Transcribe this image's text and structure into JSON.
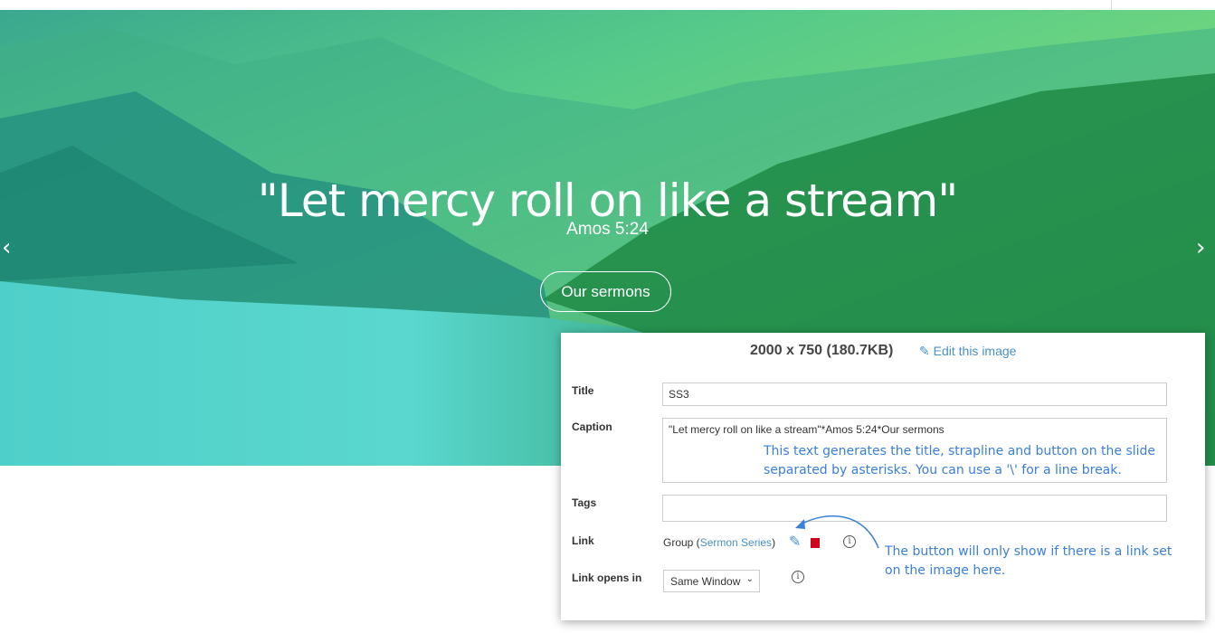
{
  "slide": {
    "title": "\"Let mercy roll on like a stream\"",
    "strapline": "Amos 5:24",
    "button_label": "Our sermons",
    "prev_icon": "chevron-left-icon",
    "next_icon": "chevron-right-icon"
  },
  "panel": {
    "dimensions": "2000 x 750 (180.7KB)",
    "edit_label": "Edit this image",
    "title_label": "Title",
    "title_value": "SS3",
    "caption_label": "Caption",
    "caption_value": "\"Let mercy roll on like a stream\"*Amos 5:24*Our sermons",
    "caption_note_1": "This text generates the title, strapline and button on the slide",
    "caption_note_2": "separated by asterisks. You can use a '\\' for a line break.",
    "tags_label": "Tags",
    "tags_value": "",
    "link_label": "Link",
    "link_prefix": "Group (",
    "link_target": "Sermon Series",
    "link_suffix": ")",
    "link_note_1": "The button will only show if there is a link set",
    "link_note_2": "on the image here.",
    "link_opens_label": "Link opens in",
    "link_opens_value": "Same Window"
  },
  "colors": {
    "accent": "#4a90c8",
    "note": "#3a7fd8",
    "delete": "#d0021b"
  }
}
